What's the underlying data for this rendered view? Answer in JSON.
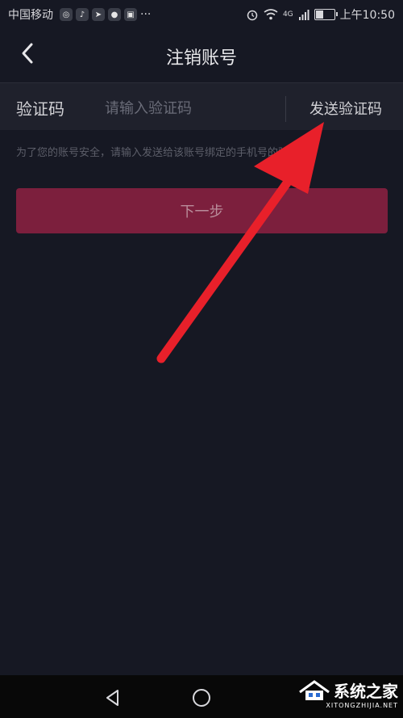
{
  "status_bar": {
    "carrier": "中国移动",
    "time": "上午10:50",
    "network": "4G",
    "more_indicator": "···"
  },
  "nav": {
    "title": "注销账号",
    "back_icon": "chevron-left-icon"
  },
  "verification": {
    "label": "验证码",
    "placeholder": "请输入验证码",
    "value": "",
    "send_label": "发送验证码"
  },
  "hint_text": "为了您的账号安全，请输入发送给该账号绑定的手机号的验证码。",
  "next_button": {
    "label": "下一步"
  },
  "annotation": {
    "type": "arrow",
    "color": "#e8202a"
  },
  "system_nav": {
    "back_icon": "triangle-back-icon",
    "home_icon": "circle-home-icon"
  },
  "watermark": {
    "text": "系统之家",
    "url": "XITONGZHIJIA.NET"
  },
  "colors": {
    "background": "#161823",
    "input_row": "#1f212c",
    "button": "#7c1f3d",
    "arrow": "#e8202a"
  }
}
